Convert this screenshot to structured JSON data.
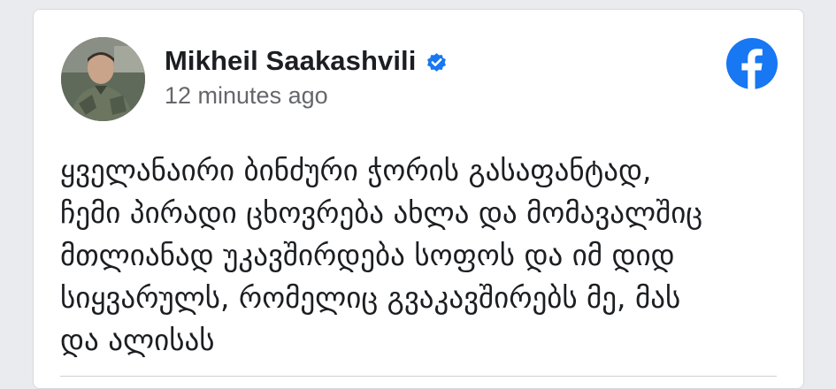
{
  "post": {
    "author_name": "Mikheil Saakashvili",
    "timestamp": "12 minutes ago",
    "verified": true,
    "text_lines": [
      "ყველანაირი ბინძური ჭორის გასაფანტად,",
      "ჩემი პირადი ცხოვრება ახლა და მომავალშიც",
      "მთლიანად უკავშირდება სოფოს და იმ დიდ",
      "სიყვარულს, რომელიც გვაკავშირებს მე, მას",
      "და ალისას"
    ]
  },
  "icons": {
    "avatar": "profile-photo",
    "verified": "verified-badge-icon",
    "platform": "facebook-logo-icon"
  },
  "colors": {
    "facebook_blue": "#1877f2",
    "text_primary": "#1c1e21",
    "text_secondary": "#65676b"
  }
}
